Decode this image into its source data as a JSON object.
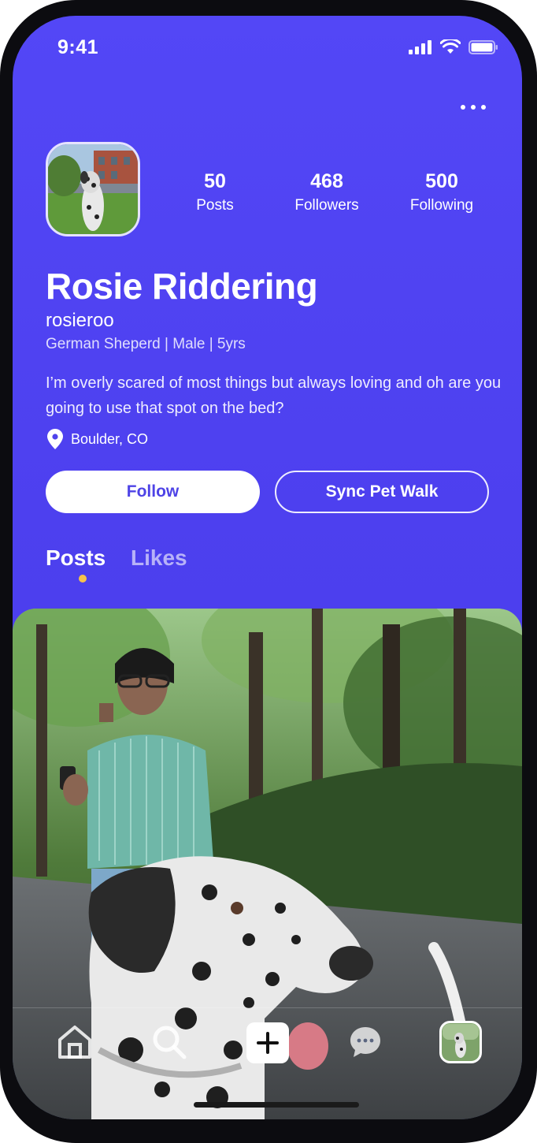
{
  "status_bar": {
    "time": "9:41"
  },
  "profile": {
    "display_name": "Rosie Riddering",
    "handle": "rosieroo",
    "details": "German Sheperd | Male | 5yrs",
    "bio": "I’m overly scared of most things but always loving and oh are you going to use that spot on the bed?",
    "location": "Boulder, CO"
  },
  "stats": [
    {
      "value": "50",
      "label": "Posts"
    },
    {
      "value": "468",
      "label": "Followers"
    },
    {
      "value": "500",
      "label": "Following"
    }
  ],
  "actions": {
    "follow_label": "Follow",
    "sync_label": "Sync Pet Walk"
  },
  "tabs": {
    "posts": "Posts",
    "likes": "Likes",
    "active": "posts"
  },
  "colors": {
    "accent": "#5347f6",
    "indicator": "#f6c24b"
  },
  "nav_icons": [
    "home-icon",
    "search-icon",
    "add-post-icon",
    "messages-icon",
    "profile-avatar"
  ]
}
